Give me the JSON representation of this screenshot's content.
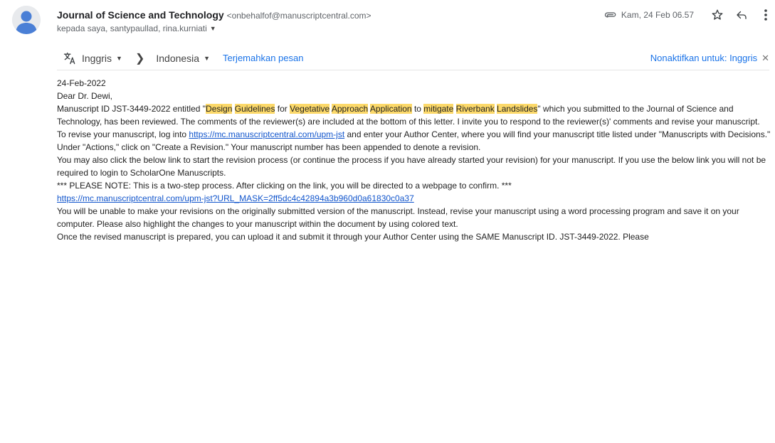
{
  "sender": {
    "name": "Journal of Science and Technology",
    "email": "<onbehalfof@manuscriptcentral.com>",
    "recipients": "kepada saya, santypaullad, rina.kurniati"
  },
  "meta": {
    "date": "Kam, 24 Feb 06.57"
  },
  "translate": {
    "from_lang": "Inggris",
    "to_lang": "Indonesia",
    "translate_link": "Terjemahkan pesan",
    "disable_link": "Nonaktifkan untuk: Inggris"
  },
  "body": {
    "date": "24-Feb-2022",
    "greeting": "Dear Dr. Dewi,",
    "p1": {
      "a": "Manuscript ID JST-3449-2022 entitled \"",
      "t1": "Design",
      "s1": " ",
      "t2": "Guidelines",
      "s2": " for ",
      "t3": "Vegetative",
      "s3": " ",
      "t4": "Approach",
      "s4": " ",
      "t5": "Application",
      "s5": " to ",
      "t6": "mitigate",
      "s6": " ",
      "t7": "Riverbank",
      "s7": " ",
      "t8": "Landslides",
      "b": "\" which you submitted to the Journal of Science and Technology, has been reviewed.  The comments of the reviewer(s) are included at the bottom of this letter. I invite you to respond to the reviewer(s)' comments and revise your manuscript."
    },
    "p2": {
      "a": "To revise your manuscript, log into ",
      "link": "https://mc.manuscriptcentral.com/upm-jst",
      "b": " and enter your Author Center, where you will find your manuscript title listed under \"Manuscripts with Decisions.\"  Under \"Actions,\" click on \"Create a Revision.\"  Your manuscript number has been appended to denote a revision."
    },
    "p3": "You may also click the below link to start the revision process (or continue the process if you have already started your revision) for your manuscript. If you use the below link you will not be required to login to ScholarOne Manuscripts.",
    "p4": "*** PLEASE NOTE: This is a two-step process. After clicking on the link, you will be directed to a webpage to confirm. ***",
    "link2": "https://mc.manuscriptcentral.com/upm-jst?URL_MASK=2ff5dc4c42894a3b960d0a61830c0a37",
    "p5": "You will be unable to make your revisions on the originally submitted version of the manuscript.  Instead, revise your manuscript using a word processing program and save it on your computer.  Please also highlight the changes to your manuscript within the document by using colored text.",
    "p6": "Once the revised manuscript is prepared, you can upload it and submit it through your Author Center using the SAME Manuscript ID. JST-3449-2022. Please"
  },
  "colors": {
    "highlight": "#fcd96a",
    "link": "#1155cc",
    "translate_link": "#1a73e8"
  }
}
